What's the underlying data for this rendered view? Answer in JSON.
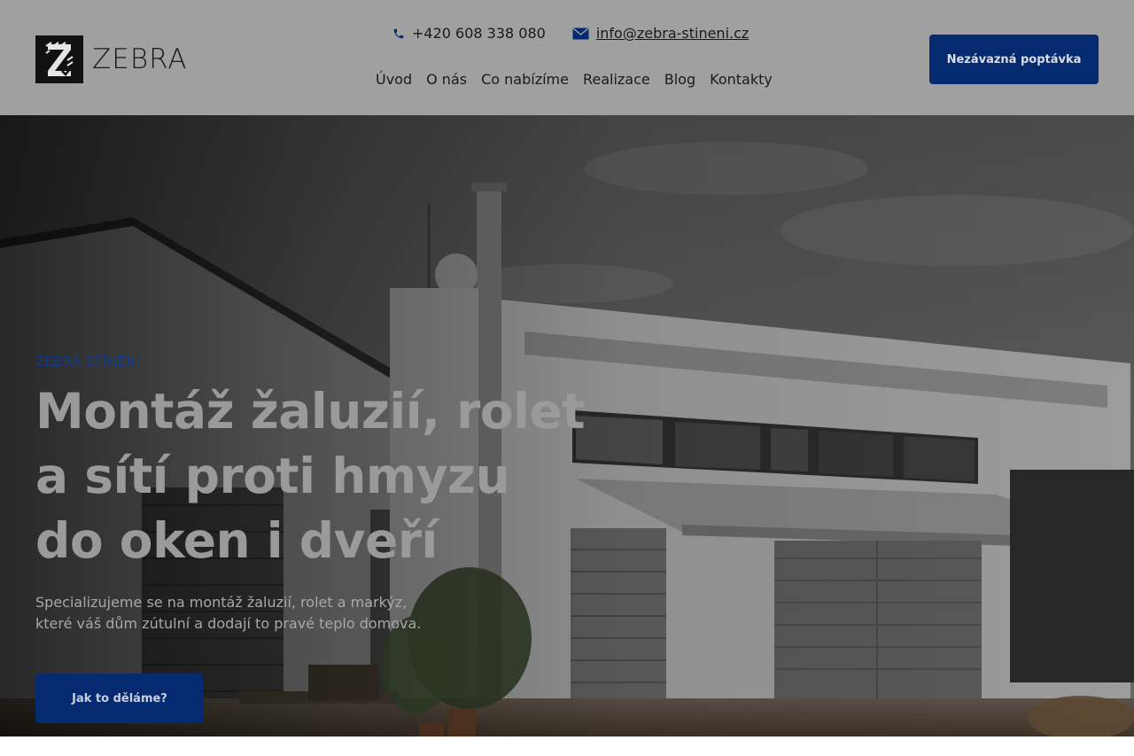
{
  "header": {
    "logo_text": "ZEBRA",
    "phone": "+420 608 338 080",
    "email": "info@zebra-stineni.cz",
    "nav": [
      {
        "label": "Úvod"
      },
      {
        "label": "O nás"
      },
      {
        "label": "Co nabízíme"
      },
      {
        "label": "Realizace"
      },
      {
        "label": "Blog"
      },
      {
        "label": "Kontakty"
      }
    ],
    "cta_label": "Nezávazná poptávka"
  },
  "hero": {
    "eyebrow": "ZEBRA STÍNĚNÍ",
    "headline_lines": [
      "Montáž žaluzií, rolet",
      "a sítí proti hmyzu",
      "do oken i dveří"
    ],
    "lead_lines": [
      "Specializujeme se na montáž žaluzií, rolet a markýz,",
      "které váš dům zútulní a dodají to pravé teplo domova."
    ],
    "cta_label": "Jak to děláme?"
  },
  "icons": {
    "phone": "phone-icon",
    "email": "envelope-icon"
  },
  "colors": {
    "header_bg": "#a0a0a0",
    "brand_blue": "#062a70",
    "eyebrow_blue": "#123a8a"
  }
}
